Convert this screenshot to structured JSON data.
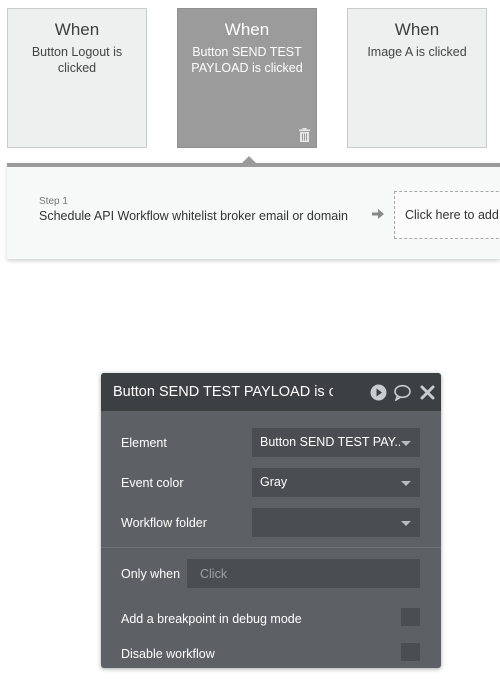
{
  "events": [
    {
      "when": "When",
      "desc": "Button Logout is clicked"
    },
    {
      "when": "When",
      "desc": "Button SEND TEST PAYLOAD is clicked"
    },
    {
      "when": "When",
      "desc": "Image A is clicked"
    }
  ],
  "step": {
    "label": "Step 1",
    "text": "Schedule API Workflow whitelist broker email or domain",
    "add_action": "Click here to add an action..."
  },
  "panel": {
    "title": "Button SEND TEST PAYLOAD is clicked",
    "element_label": "Element",
    "element_value": "Button SEND TEST PAY...",
    "event_color_label": "Event color",
    "event_color_value": "Gray",
    "workflow_folder_label": "Workflow folder",
    "workflow_folder_value": "",
    "only_when_label": "Only when",
    "only_when_placeholder": "Click",
    "breakpoint_label": "Add a breakpoint in debug mode",
    "disable_label": "Disable workflow"
  },
  "colors": {
    "selected_card": "#9b9b9b",
    "card": "#eef0f0",
    "panel_bg": "#5d6064",
    "panel_header": "#3d4043"
  },
  "icons": [
    "trash-icon",
    "arrow-right-icon",
    "play-icon",
    "comment-icon",
    "close-icon",
    "chevron-down-icon"
  ]
}
